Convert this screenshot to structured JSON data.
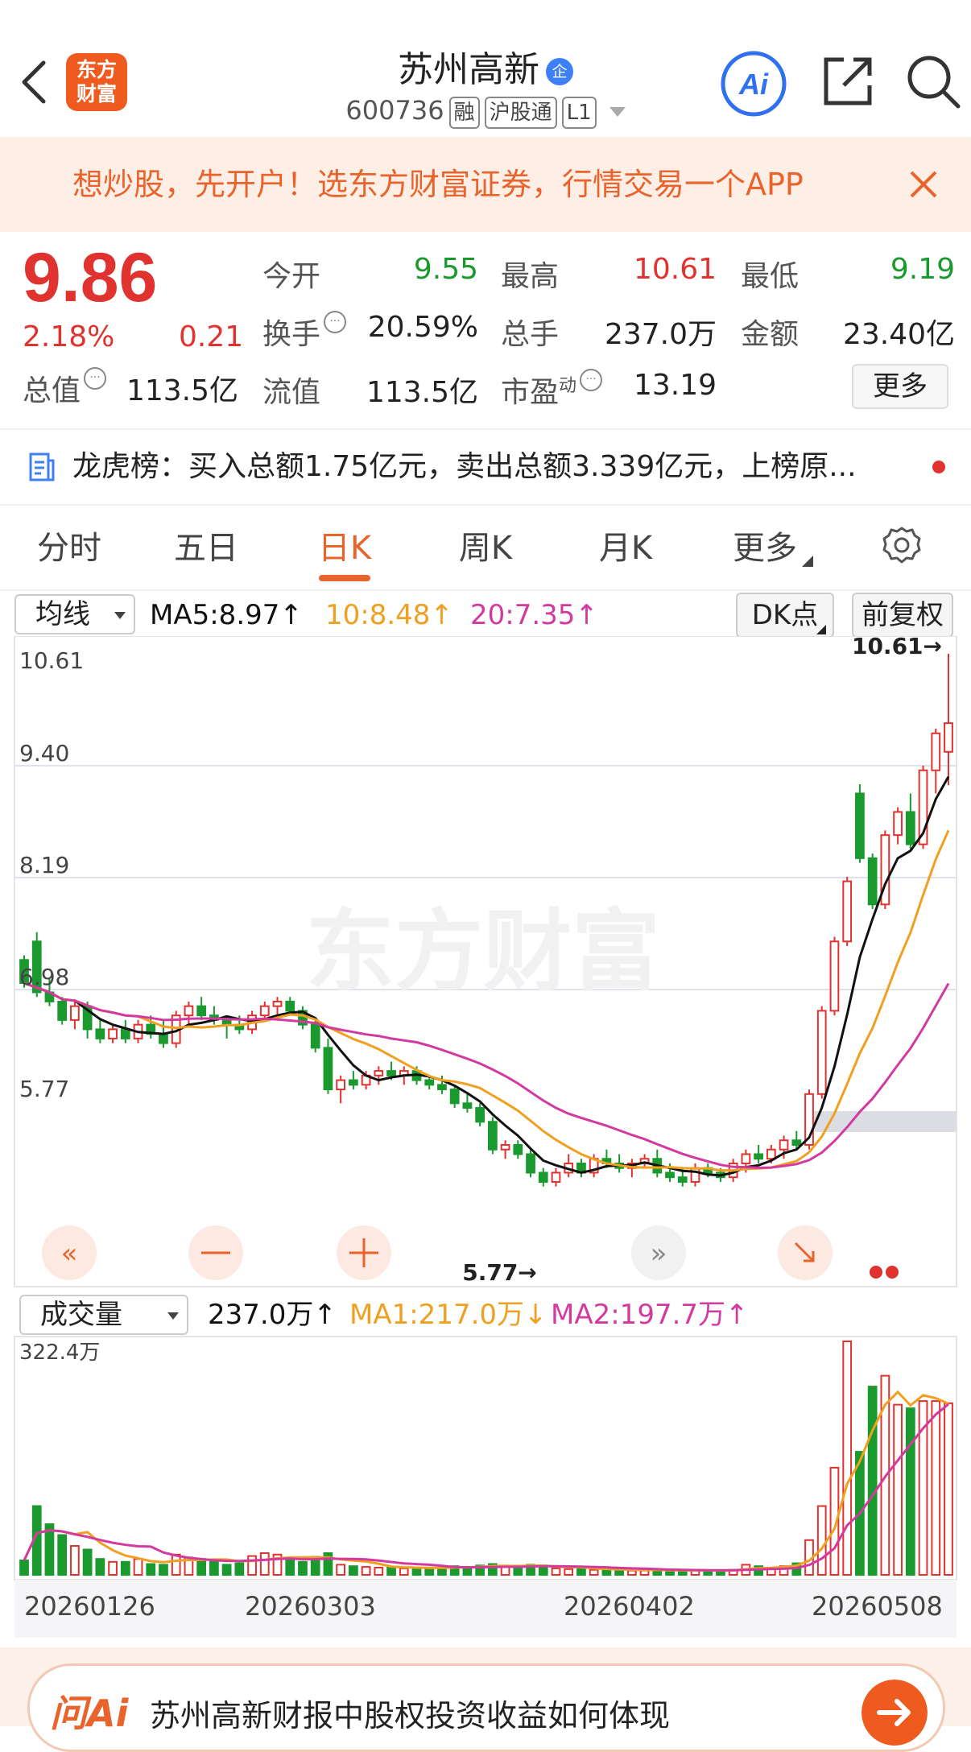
{
  "header": {
    "back_icon": "chevron-left-icon",
    "logo_line1": "东方",
    "logo_line2": "财富",
    "stock_name": "苏州高新",
    "name_badge": "企",
    "stock_code": "600736",
    "tags": [
      "融",
      "沪股通",
      "L1"
    ],
    "ai_label": "Ai",
    "share_icon": "share-icon",
    "search_icon": "search-icon"
  },
  "banner": {
    "text": "想炒股，先开户！选东方财富证券，行情交易一个APP",
    "close_icon": "close-icon"
  },
  "quote": {
    "price": "9.86",
    "change_pct": "2.18%",
    "change_amt": "0.21",
    "total_value_label": "总值",
    "total_value": "113.5亿",
    "open_label": "今开",
    "open": "9.55",
    "high_label": "最高",
    "high": "10.61",
    "low_label": "最低",
    "low": "9.19",
    "turnover_label": "换手",
    "turnover": "20.59%",
    "volume_label": "总手",
    "volume": "237.0万",
    "amount_label": "金额",
    "amount": "23.40亿",
    "float_label": "流值",
    "float_value": "113.5亿",
    "pe_label": "市盈",
    "pe_sup": "动",
    "pe": "13.19",
    "more_label": "更多",
    "info_icon": "···"
  },
  "dragon_tiger": {
    "text": "龙虎榜：买入总额1.75亿元，卖出总额3.339亿元，上榜原..."
  },
  "tabs": [
    "分时",
    "五日",
    "日K",
    "周K",
    "月K",
    "更多"
  ],
  "active_tab": "日K",
  "ma_bar": {
    "select_label": "均线",
    "ma5": "MA5:8.97↑",
    "ma10": "10:8.48↑",
    "ma20": "20:7.35↑",
    "dk_label": "DK点",
    "fq_label": "前复权"
  },
  "vol_bar": {
    "select_label": "成交量",
    "vol": "237.0万↑",
    "ma1": "MA1:217.0万↓",
    "ma2": "MA2:197.7万↑"
  },
  "colors": {
    "up": "#e0322f",
    "down": "#1a9a2e",
    "ma5": "#111111",
    "ma10": "#f0a020",
    "ma20": "#d23aa0",
    "accent": "#e8642c"
  },
  "chart_data": {
    "type": "candlestick",
    "y_ticks": [
      "10.61",
      "9.40",
      "8.19",
      "6.98",
      "5.77"
    ],
    "ylim": [
      5.77,
      10.61
    ],
    "max_label": "10.61→",
    "min_label": "5.77→",
    "watermark": "东方财富",
    "x_ticks": [
      "20260126",
      "20260303",
      "20260402",
      "20260508"
    ],
    "volume_axis_label": "322.4万",
    "volume_max": 322.4,
    "candles": [
      [
        7.3,
        7.35,
        7.0,
        7.05,
        20
      ],
      [
        7.5,
        7.6,
        6.9,
        6.95,
        95
      ],
      [
        6.95,
        7.1,
        6.8,
        6.85,
        70
      ],
      [
        6.85,
        6.9,
        6.6,
        6.65,
        55
      ],
      [
        6.65,
        6.85,
        6.55,
        6.8,
        40
      ],
      [
        6.8,
        6.85,
        6.45,
        6.55,
        35
      ],
      [
        6.55,
        6.65,
        6.4,
        6.45,
        22
      ],
      [
        6.45,
        6.6,
        6.4,
        6.55,
        18
      ],
      [
        6.55,
        6.65,
        6.4,
        6.45,
        18
      ],
      [
        6.45,
        6.65,
        6.4,
        6.6,
        22
      ],
      [
        6.6,
        6.7,
        6.45,
        6.5,
        15
      ],
      [
        6.5,
        6.65,
        6.35,
        6.4,
        14
      ],
      [
        6.4,
        6.75,
        6.35,
        6.7,
        28
      ],
      [
        6.7,
        6.85,
        6.6,
        6.8,
        24
      ],
      [
        6.8,
        6.9,
        6.65,
        6.7,
        22
      ],
      [
        6.7,
        6.8,
        6.6,
        6.65,
        18
      ],
      [
        6.65,
        6.7,
        6.45,
        6.6,
        14
      ],
      [
        6.6,
        6.7,
        6.5,
        6.55,
        16
      ],
      [
        6.55,
        6.75,
        6.5,
        6.7,
        26
      ],
      [
        6.7,
        6.85,
        6.65,
        6.8,
        30
      ],
      [
        6.8,
        6.9,
        6.7,
        6.85,
        28
      ],
      [
        6.85,
        6.9,
        6.7,
        6.75,
        20
      ],
      [
        6.75,
        6.8,
        6.55,
        6.6,
        18
      ],
      [
        6.6,
        6.65,
        6.3,
        6.35,
        25
      ],
      [
        6.35,
        6.45,
        5.85,
        5.9,
        30
      ],
      [
        5.9,
        6.05,
        5.75,
        6.0,
        14
      ],
      [
        6.0,
        6.1,
        5.9,
        5.95,
        12
      ],
      [
        5.95,
        6.1,
        5.9,
        6.05,
        11
      ],
      [
        6.05,
        6.15,
        5.95,
        6.1,
        10
      ],
      [
        6.1,
        6.2,
        6.0,
        6.05,
        10
      ],
      [
        6.05,
        6.15,
        5.95,
        6.1,
        9
      ],
      [
        6.1,
        6.15,
        5.95,
        6.0,
        10
      ],
      [
        6.0,
        6.05,
        5.9,
        5.95,
        9
      ],
      [
        5.95,
        6.05,
        5.85,
        5.9,
        10
      ],
      [
        5.9,
        5.95,
        5.7,
        5.75,
        12
      ],
      [
        5.75,
        5.85,
        5.65,
        5.7,
        11
      ],
      [
        5.7,
        5.75,
        5.5,
        5.55,
        13
      ],
      [
        5.55,
        5.6,
        5.2,
        5.25,
        15
      ],
      [
        5.25,
        5.35,
        5.15,
        5.3,
        12
      ],
      [
        5.3,
        5.35,
        5.15,
        5.2,
        10
      ],
      [
        5.2,
        5.25,
        4.95,
        5.0,
        14
      ],
      [
        5.0,
        5.05,
        4.85,
        4.9,
        13
      ],
      [
        4.9,
        5.05,
        4.85,
        5.0,
        9
      ],
      [
        5.0,
        5.2,
        4.95,
        5.1,
        8
      ],
      [
        5.1,
        5.15,
        4.95,
        5.0,
        8
      ],
      [
        5.0,
        5.2,
        4.95,
        5.15,
        7
      ],
      [
        5.15,
        5.25,
        5.05,
        5.1,
        8
      ],
      [
        5.1,
        5.2,
        5.0,
        5.05,
        7
      ],
      [
        5.05,
        5.15,
        4.95,
        5.1,
        6
      ],
      [
        5.1,
        5.2,
        5.05,
        5.15,
        6
      ],
      [
        5.15,
        5.25,
        4.95,
        5.0,
        7
      ],
      [
        5.0,
        5.1,
        4.9,
        4.95,
        6
      ],
      [
        4.95,
        5.05,
        4.85,
        4.9,
        6
      ],
      [
        4.9,
        5.1,
        4.85,
        5.05,
        6
      ],
      [
        5.05,
        5.1,
        4.95,
        5.0,
        6
      ],
      [
        5.0,
        5.05,
        4.9,
        4.95,
        6
      ],
      [
        4.95,
        5.15,
        4.9,
        5.1,
        7
      ],
      [
        5.1,
        5.25,
        5.0,
        5.2,
        14
      ],
      [
        5.2,
        5.3,
        5.1,
        5.15,
        12
      ],
      [
        5.15,
        5.3,
        5.1,
        5.25,
        10
      ],
      [
        5.25,
        5.4,
        5.15,
        5.35,
        12
      ],
      [
        5.35,
        5.45,
        5.25,
        5.3,
        16
      ],
      [
        5.3,
        5.9,
        5.25,
        5.85,
        48
      ],
      [
        5.85,
        6.8,
        5.8,
        6.75,
        95
      ],
      [
        6.75,
        7.55,
        6.7,
        7.5,
        148
      ],
      [
        7.5,
        8.2,
        7.45,
        8.15,
        322.4
      ],
      [
        9.1,
        9.2,
        8.35,
        8.4,
        170
      ],
      [
        8.4,
        8.45,
        7.85,
        7.9,
        260
      ],
      [
        7.9,
        8.7,
        7.85,
        8.65,
        275
      ],
      [
        8.65,
        8.95,
        8.55,
        8.9,
        235
      ],
      [
        8.9,
        9.1,
        8.5,
        8.55,
        230
      ],
      [
        8.55,
        9.4,
        8.5,
        9.35,
        240
      ],
      [
        9.35,
        9.8,
        9.1,
        9.75,
        240
      ],
      [
        9.55,
        10.61,
        9.19,
        9.86,
        237
      ]
    ]
  },
  "ask": {
    "logo": "问Ai",
    "text": "苏州高新财报中股权投资收益如何体现"
  }
}
